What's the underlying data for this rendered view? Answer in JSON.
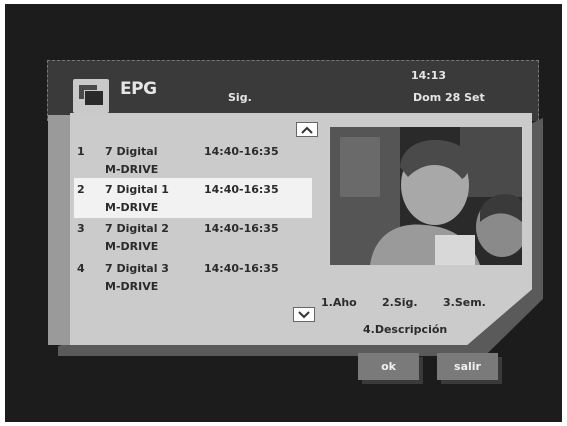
{
  "header": {
    "icon": "epg-guide-icon",
    "title": "EPG",
    "view": "Sig.",
    "time": "14:13",
    "date": "Dom 28 Set"
  },
  "programs": [
    {
      "num": "1",
      "channel": "7 Digital",
      "time": "14:40-16:35",
      "title": "M-DRIVE"
    },
    {
      "num": "2",
      "channel": "7 Digital 1",
      "time": "14:40-16:35",
      "title": "M-DRIVE"
    },
    {
      "num": "3",
      "channel": "7 Digital 2",
      "time": "14:40-16:35",
      "title": "M-DRIVE"
    },
    {
      "num": "4",
      "channel": "7 Digital 3",
      "time": "14:40-16:35",
      "title": "M-DRIVE"
    }
  ],
  "selected_row": 2,
  "nav": {
    "opt1": "1.Aho",
    "opt2": "2.Sig.",
    "opt3": "3.Sem.",
    "opt4": "4.Descripción"
  },
  "buttons": {
    "ok": "ok",
    "exit": "salir"
  },
  "icons": {
    "scroll_up": "chevron-up-icon",
    "scroll_down": "chevron-down-icon"
  },
  "colors": {
    "background": "#1c1c1c",
    "panel": "#cbcbcb",
    "highlight": "#f2f2f2",
    "button": "#7a7a7a"
  }
}
